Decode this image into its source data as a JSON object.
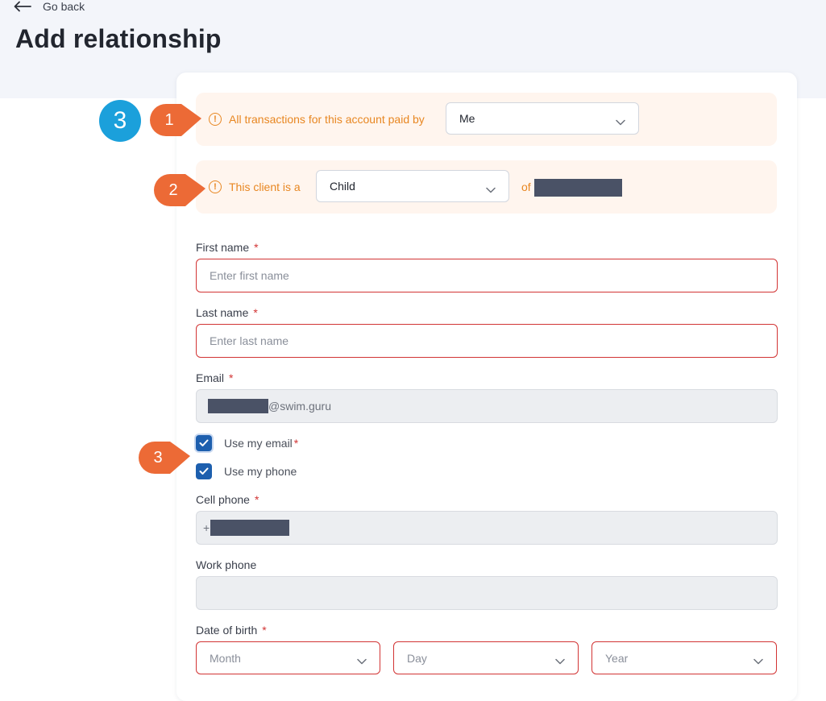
{
  "nav": {
    "back_label": "Go back"
  },
  "page": {
    "title": "Add relationship"
  },
  "paid_by": {
    "text": "All transactions for this account paid by",
    "value": "Me"
  },
  "client_relation": {
    "text": "This client is a",
    "value": "Child",
    "of_label": "of"
  },
  "form": {
    "first_name": {
      "label": "First name",
      "required": "*",
      "placeholder": "Enter first name"
    },
    "last_name": {
      "label": "Last name",
      "required": "*",
      "placeholder": "Enter last name"
    },
    "email": {
      "label": "Email",
      "required": "*",
      "value_suffix": "@swim.guru"
    },
    "use_my_email": {
      "label": "Use my email",
      "required": "*"
    },
    "use_my_phone": {
      "label": "Use my phone"
    },
    "cell_phone": {
      "label": "Cell phone",
      "required": "*",
      "prefix": "+"
    },
    "work_phone": {
      "label": "Work phone"
    },
    "dob": {
      "label": "Date of birth",
      "required": "*",
      "month": "Month",
      "day": "Day",
      "year": "Year"
    }
  },
  "annotations": {
    "step_badge": "3",
    "callout_1": "1",
    "callout_2": "2",
    "callout_3": "3"
  },
  "colors": {
    "accent_orange": "#e88722",
    "callout_orange": "#ec6a36",
    "badge_blue": "#1ba0db",
    "error_red": "#d23434",
    "checkbox_blue": "#1d5fae"
  }
}
